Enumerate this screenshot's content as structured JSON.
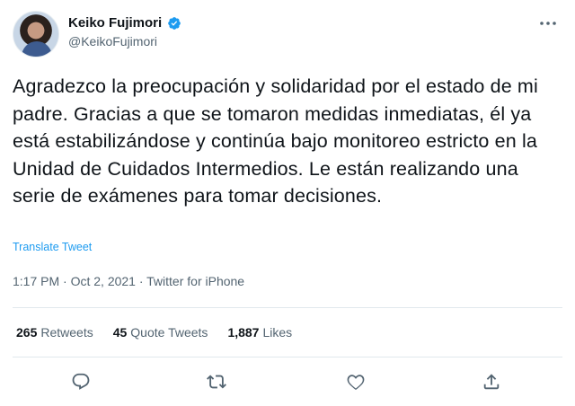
{
  "user": {
    "display_name": "Keiko Fujimori",
    "handle": "@KeikoFujimori",
    "verified": true
  },
  "tweet": {
    "text": "Agradezco la preocupación y solidaridad por el estado de mi padre. Gracias a que se tomaron medidas inmediatas, él ya está estabilizándose y continúa bajo monitoreo estricto en la Unidad de Cuidados Intermedios. Le están realizando una serie de exámenes para tomar decisiones.",
    "translate_label": "Translate Tweet",
    "meta": "1:17 PM · Oct 2, 2021 · Twitter for iPhone"
  },
  "stats": [
    {
      "count": "265",
      "label": "Retweets"
    },
    {
      "count": "45",
      "label": "Quote Tweets"
    },
    {
      "count": "1,887",
      "label": "Likes"
    }
  ],
  "actions": [
    "reply-icon",
    "retweet-icon",
    "like-icon",
    "share-icon"
  ],
  "colors": {
    "accent": "#1d9bf0",
    "text": "#0f1419",
    "secondary": "#536471",
    "divider": "#e1e8ed"
  }
}
